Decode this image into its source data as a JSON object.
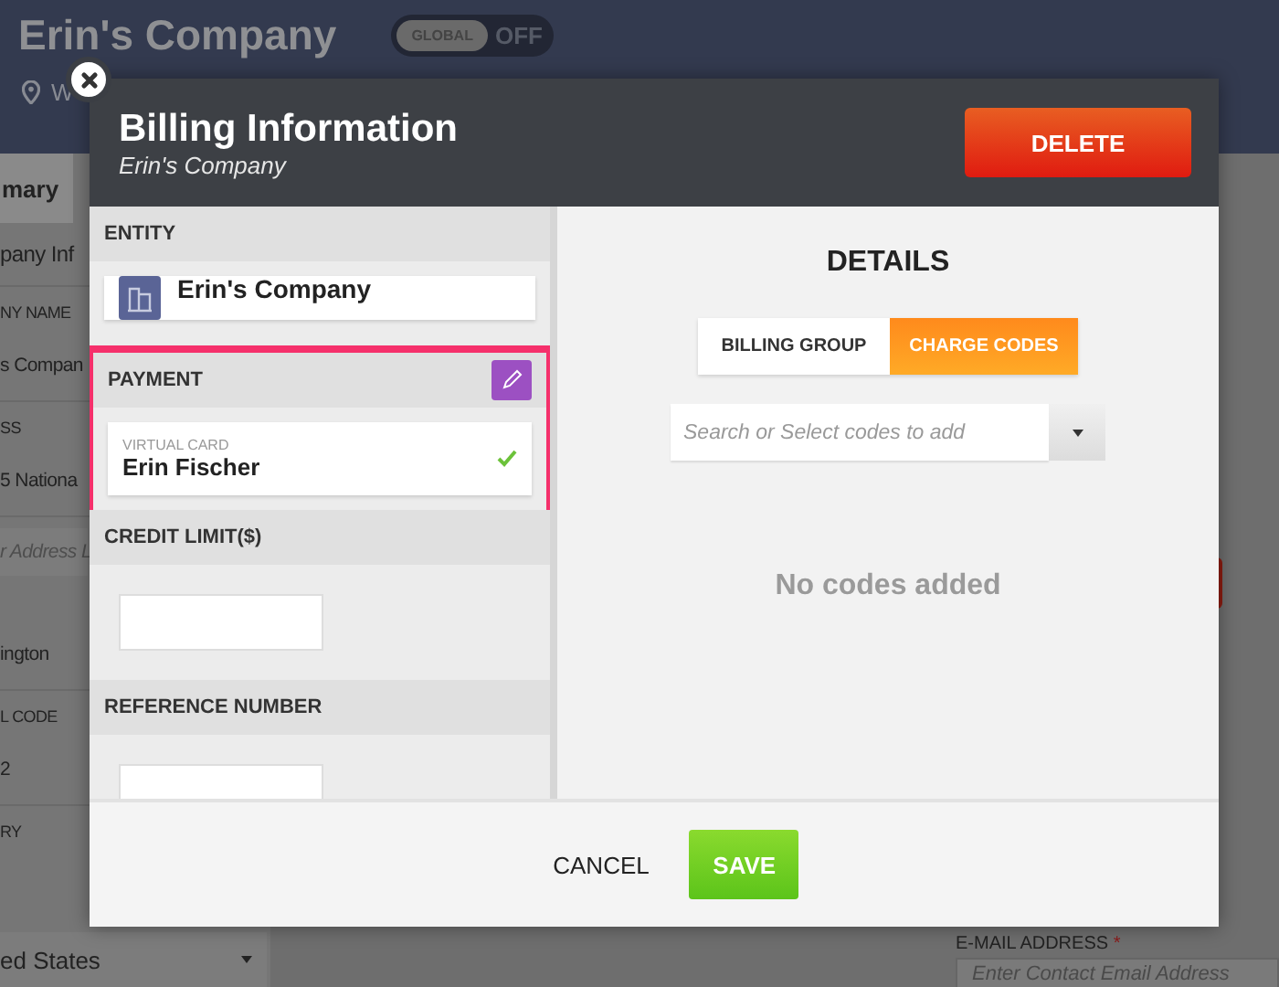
{
  "background": {
    "title": "Erin's Company",
    "global_toggle": {
      "label": "GLOBAL",
      "state": "OFF",
      "on": false
    },
    "location": "W",
    "tab": "mary",
    "rows": [
      {
        "kind": "heading",
        "text": "pany Inf"
      },
      {
        "kind": "label",
        "text": "NY NAME"
      },
      {
        "kind": "value",
        "text": "s Compan"
      },
      {
        "kind": "label",
        "text": "SS"
      },
      {
        "kind": "value",
        "text": "5 Nationa"
      },
      {
        "kind": "placeholder",
        "text": "r Address L"
      },
      {
        "kind": "value",
        "text": "ington"
      },
      {
        "kind": "label",
        "text": "L CODE"
      },
      {
        "kind": "value",
        "text": "2"
      },
      {
        "kind": "label",
        "text": "RY"
      }
    ],
    "country_select": "ed States",
    "email_label": "E-MAIL ADDRESS",
    "email_required": "*",
    "email_placeholder": "Enter Contact Email Address"
  },
  "modal": {
    "title": "Billing Information",
    "subtitle": "Erin's Company",
    "delete_button": "DELETE",
    "entity": {
      "header": "ENTITY",
      "name": "Erin's Company"
    },
    "payment": {
      "header": "PAYMENT",
      "highlighted": true,
      "card_type": "VIRTUAL CARD",
      "card_name": "Erin Fischer",
      "verified": true
    },
    "credit_limit": {
      "header": "CREDIT LIMIT($)"
    },
    "reference_number": {
      "header": "REFERENCE NUMBER"
    },
    "details": {
      "title": "DETAILS",
      "tabs": [
        {
          "label": "BILLING GROUP",
          "selected": false
        },
        {
          "label": "CHARGE CODES",
          "selected": true
        }
      ],
      "search": {
        "placeholder": "Search or Select codes to add"
      },
      "empty_message": "No codes added"
    },
    "buttons": {
      "cancel": "CANCEL",
      "save": "SAVE"
    }
  }
}
